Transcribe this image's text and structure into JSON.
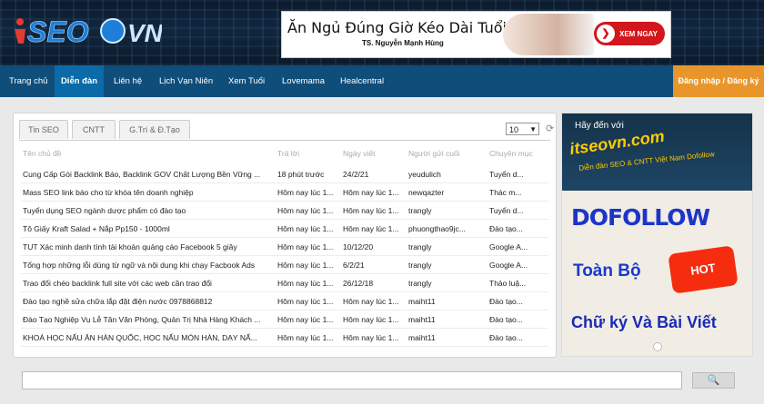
{
  "header": {
    "logo_text": "iTSEOVN",
    "ad": {
      "title": "Ăn Ngủ Đúng Giờ Kéo Dài Tuổi Thọ",
      "author": "TS. Nguyễn Mạnh Hùng",
      "button": "XEM NGAY"
    }
  },
  "nav": {
    "items": [
      "Trang chủ",
      "Diễn đàn",
      "Liên hệ",
      "Lịch Vạn Niên",
      "Xem Tuổi",
      "Lovemama",
      "Healcentral"
    ],
    "active": "Diễn đàn",
    "login": "Đăng nhập / Đăng ký"
  },
  "panel": {
    "tabs": [
      "Tin SEO",
      "CNTT",
      "G.Trí & Đ.Tạo"
    ],
    "page_size": "10",
    "columns": [
      "Tên chủ đề",
      "Trả lời",
      "Ngày viết",
      "Người gửi cuối",
      "Chuyên mục"
    ],
    "rows": [
      [
        "Cung Cấp Gói Backlink Báo, Backlink GOV Chất Lượng Bền Vững ...",
        "18 phút trước",
        "24/2/21",
        "yeudulich",
        "Tuyển d..."
      ],
      [
        "Mass SEO link báo cho từ khóa tên doanh nghiệp",
        "Hôm nay lúc 1...",
        "Hôm nay lúc 1...",
        "newqazter",
        "Thác m..."
      ],
      [
        "Tuyển dụng SEO ngành dược phẩm có đào tạo",
        "Hôm nay lúc 1...",
        "Hôm nay lúc 1...",
        "trangly",
        "Tuyển d..."
      ],
      [
        "Tô Giấy Kraft Salad + Nắp Pp150 - 1000ml",
        "Hôm nay lúc 1...",
        "Hôm nay lúc 1...",
        "phuongthao9jc...",
        "Đào tạo..."
      ],
      [
        "TUT Xác minh danh tính tài khoản quảng cáo Facebook 5 giây",
        "Hôm nay lúc 1...",
        "10/12/20",
        "trangly",
        "Google A..."
      ],
      [
        "Tổng hợp những lỗi dùng từ ngữ và nội dung khi chạy Facbook Ads",
        "Hôm nay lúc 1...",
        "6/2/21",
        "trangly",
        "Google A..."
      ],
      [
        "Trao đổi chéo backlink full site với các web cần trao đổi",
        "Hôm nay lúc 1...",
        "26/12/18",
        "trangly",
        "Thảo luậ..."
      ],
      [
        "Đào tạo nghề sửa chữa lắp đặt điện nước 0978868812",
        "Hôm nay lúc 1...",
        "Hôm nay lúc 1...",
        "maiht11",
        "Đào tạo..."
      ],
      [
        "Đào Tạo Nghiệp Vụ Lễ Tân Văn Phòng, Quản Trị Nhà Hàng Khách ...",
        "Hôm nay lúc 1...",
        "Hôm nay lúc 1...",
        "maiht11",
        "Đào tạo..."
      ],
      [
        "KHOÁ HỌC NẤU ĂN HÀN QUỐC, HỌC NẤU MÓN HÀN, DẠY NẤ...",
        "Hôm nay lúc 1...",
        "Hôm nay lúc 1...",
        "maiht11",
        "Đào tạo..."
      ]
    ]
  },
  "sidebar_ad": {
    "heading": "Hãy đến với",
    "brand": "itseovn.com",
    "tagline": "Diễn đàn SEO & CNTT Việt Nam Dofollow",
    "big1": "DOFOLLOW",
    "big2": "Toàn Bộ",
    "badge": "HOT",
    "big3": "Chữ ký Và Bài Viết"
  },
  "search": {
    "placeholder": ""
  },
  "colors": {
    "nav": "#0f4d7a",
    "active_tab": "#0b6aa8",
    "login": "#e8962b",
    "ad_button": "#d3161b"
  }
}
